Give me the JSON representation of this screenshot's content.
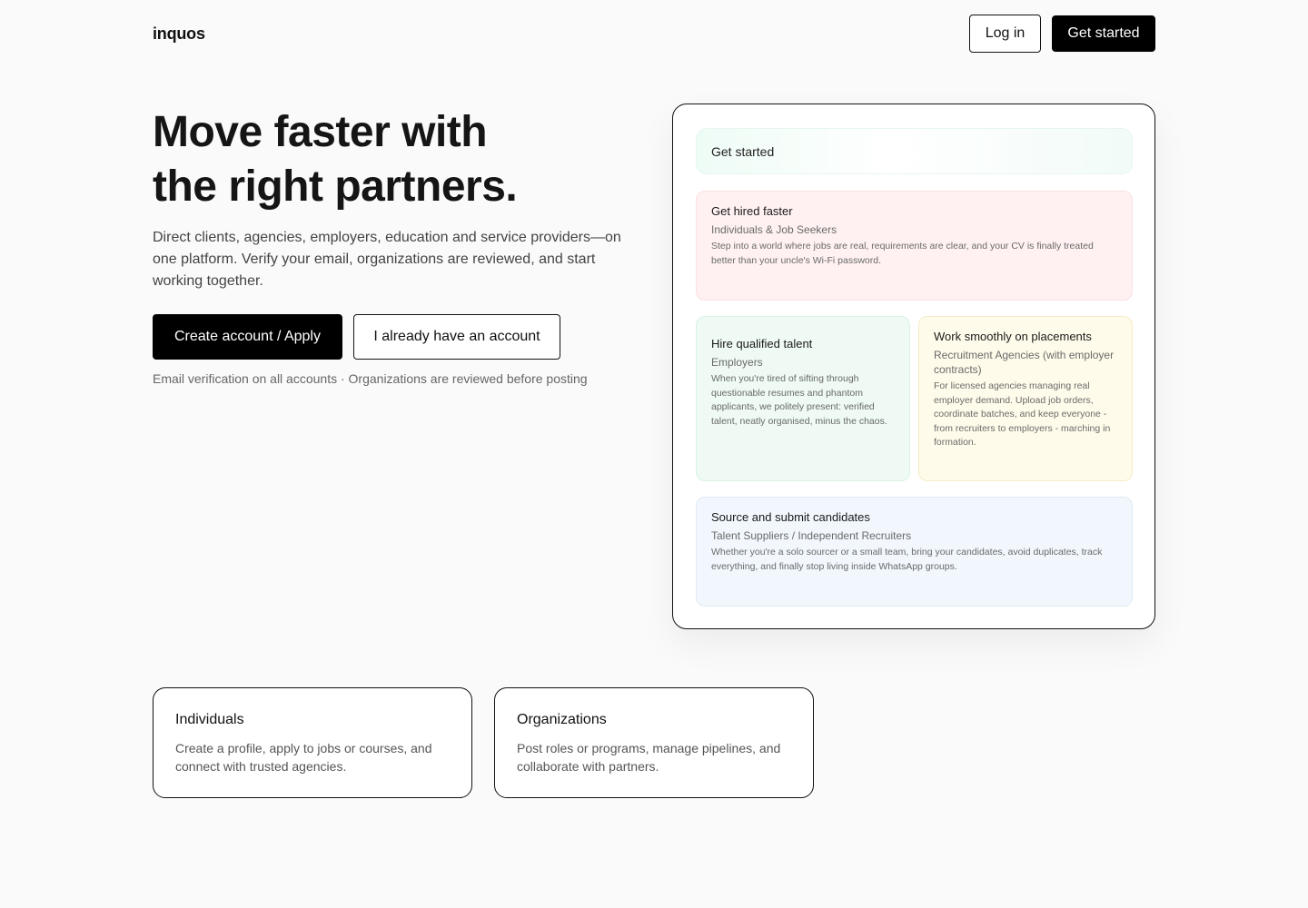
{
  "header": {
    "logo": "inquos",
    "login_label": "Log in",
    "get_started_label": "Get started"
  },
  "hero": {
    "title_line1": "Move faster with",
    "title_line2": "the right partners.",
    "subtitle": "Direct clients, agencies, employers, education and service providers—on one platform. Verify your email, organizations are reviewed, and start working together.",
    "primary_cta": "Create account / Apply",
    "secondary_cta": "I already have an account",
    "note": "Email verification on all accounts · Organizations are reviewed before posting"
  },
  "panel": {
    "heading": "Get started",
    "cards": [
      {
        "title": "Get hired faster",
        "audience": "Individuals & Job Seekers",
        "description": "Step into a world where jobs are real, requirements are clear, and your CV is finally treated better than your uncle's Wi-Fi password."
      },
      {
        "title": "Hire qualified talent",
        "audience": "Employers",
        "description": "When you're tired of sifting through questionable resumes and phantom applicants, we politely present: verified talent, neatly organised, minus the chaos."
      },
      {
        "title": "Work smoothly on placements",
        "audience": "Recruitment Agencies (with employer contracts)",
        "description": "For licensed agencies managing real employer demand. Upload job orders, coordinate batches, and keep everyone - from recruiters to employers - marching in formation."
      },
      {
        "title": "Source and submit candidates",
        "audience": "Talent Suppliers / Independent Recruiters",
        "description": "Whether you're a solo sourcer or a small team, bring your candidates, avoid duplicates, track everything, and finally stop living inside WhatsApp groups."
      }
    ]
  },
  "audiences": [
    {
      "title": "Individuals",
      "description": "Create a profile, apply to jobs or courses, and connect with trusted agencies."
    },
    {
      "title": "Organizations",
      "description": "Post roles or programs, manage pipelines, and collaborate with partners."
    }
  ],
  "colors": {
    "primary": "#000000",
    "background": "#fafafa",
    "card_red": "#fff1f1",
    "card_green": "#eefaf3",
    "card_yellow": "#fffbea",
    "card_blue": "#f1f7fd"
  }
}
